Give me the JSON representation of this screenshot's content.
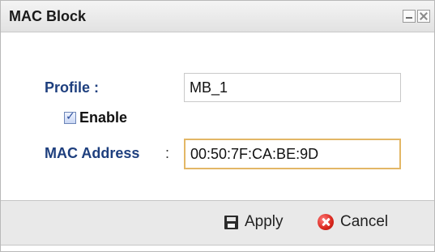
{
  "dialog": {
    "title": "MAC Block"
  },
  "form": {
    "profile_label": "Profile :",
    "profile_value": "MB_1",
    "enable_label": "Enable",
    "enable_checked": true,
    "mac_label": "MAC Address",
    "mac_colon": ":",
    "mac_value": "00:50:7F:CA:BE:9D"
  },
  "footer": {
    "apply_label": "Apply",
    "cancel_label": "Cancel"
  },
  "icons": {
    "minimize": "minimize-icon",
    "close": "close-icon",
    "apply": "save-icon",
    "cancel": "cancel-icon"
  },
  "colors": {
    "label_blue": "#1e3f7e",
    "focus_border": "#e3b766",
    "footer_bg": "#e9e9e9"
  }
}
